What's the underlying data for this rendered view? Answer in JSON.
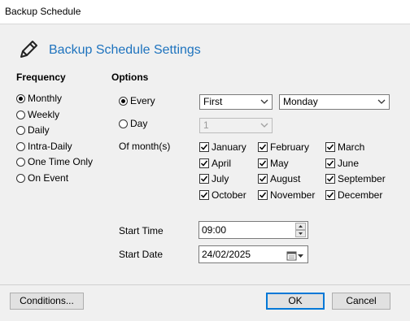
{
  "window": {
    "title": "Backup Schedule"
  },
  "header": {
    "title": "Backup Schedule Settings",
    "icon": "pencil-icon"
  },
  "frequency": {
    "heading": "Frequency",
    "options": [
      "Monthly",
      "Weekly",
      "Daily",
      "Intra-Daily",
      "One Time Only",
      "On Event"
    ],
    "selected": "Monthly"
  },
  "options": {
    "heading": "Options",
    "every_label": "Every",
    "every_selected": true,
    "every_ordinal": "First",
    "every_weekday": "Monday",
    "day_label": "Day",
    "day_value": "1",
    "months_label": "Of month(s)",
    "months": [
      "January",
      "February",
      "March",
      "April",
      "May",
      "June",
      "July",
      "August",
      "September",
      "October",
      "November",
      "December"
    ],
    "months_checked": [
      true,
      true,
      true,
      true,
      true,
      true,
      true,
      true,
      true,
      true,
      true,
      true
    ]
  },
  "start": {
    "time_label": "Start Time",
    "time_value": "09:00",
    "date_label": "Start Date",
    "date_value": "24/02/2025"
  },
  "buttons": {
    "conditions": "Conditions...",
    "ok": "OK",
    "cancel": "Cancel"
  },
  "colors": {
    "accent": "#1e73be",
    "default_button_border": "#0078d7"
  }
}
